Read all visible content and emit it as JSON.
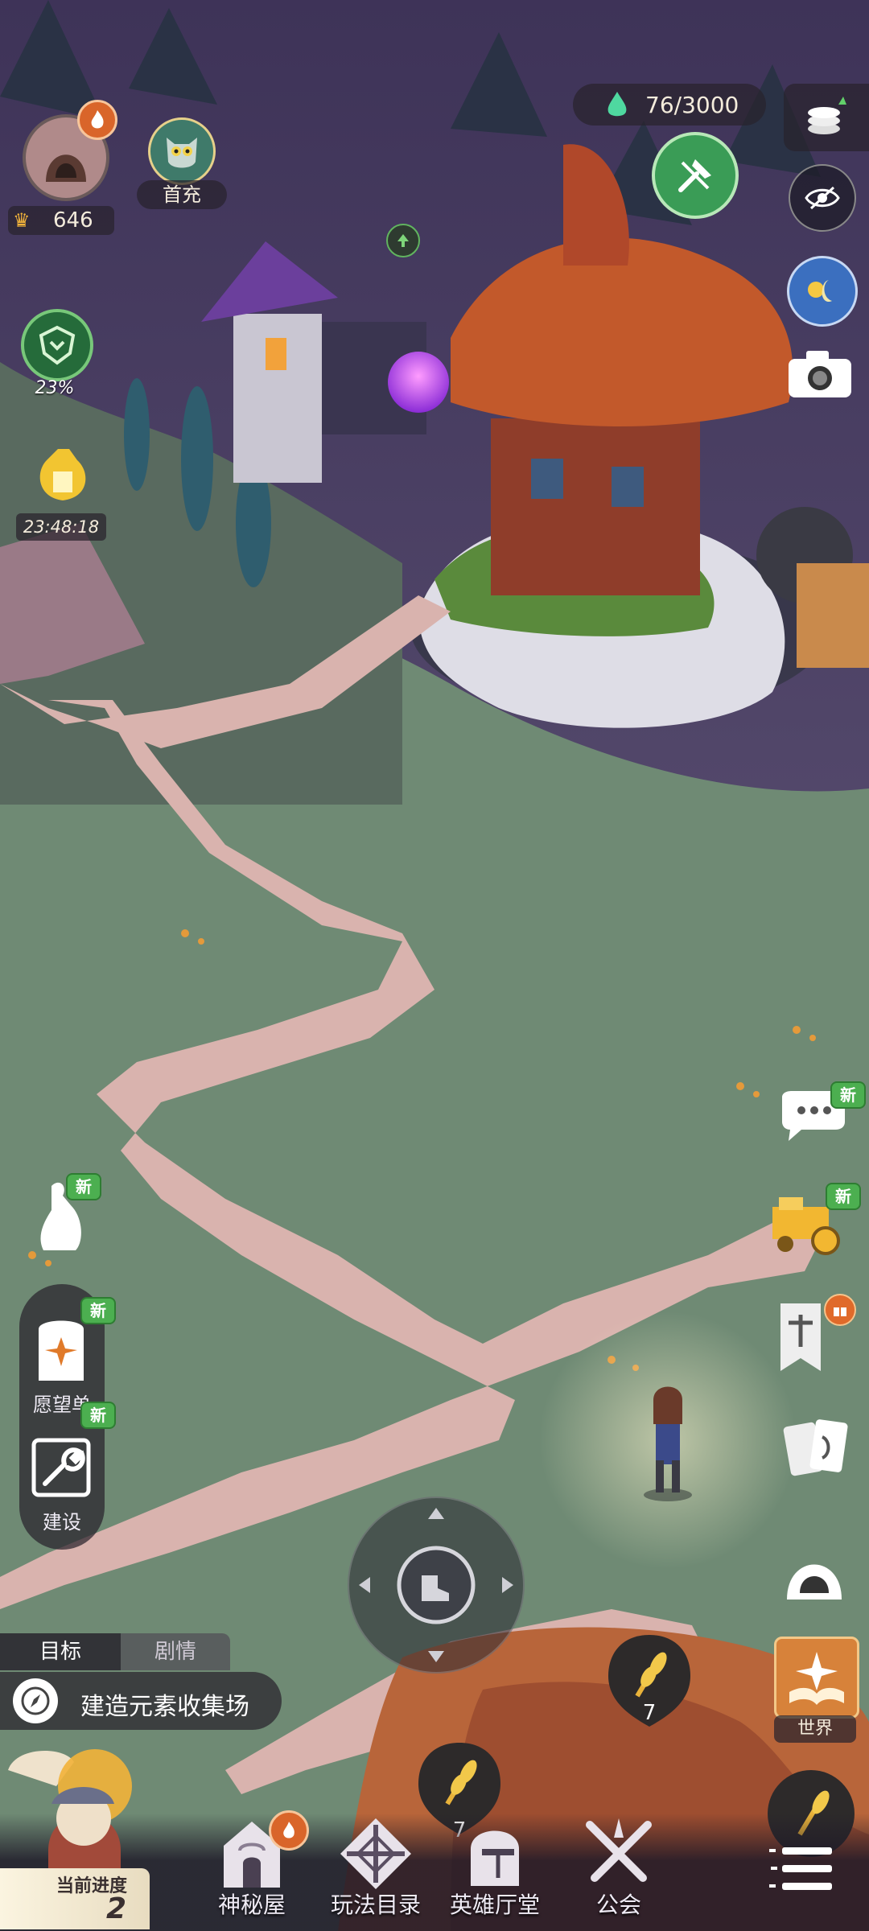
{
  "hud": {
    "player_power": "646",
    "first_recharge_label": "首充",
    "progress_percent": "23%",
    "timer": "23:48:18",
    "energy": "76/3000"
  },
  "left_panel": {
    "wishlist_label": "愿望单",
    "build_label": "建设",
    "new_badge": "新"
  },
  "quest": {
    "tab_goal": "目标",
    "tab_story": "剧情",
    "task_text": "建造元素收集场"
  },
  "right_panel": {
    "world_label": "世界",
    "new_badge": "新"
  },
  "resource_nodes": {
    "node_a_count": "7",
    "node_b_count": "7"
  },
  "bottom_nav": {
    "progress_label": "当前进度",
    "progress_value": "2",
    "items": [
      {
        "label": "神秘屋"
      },
      {
        "label": "玩法目录"
      },
      {
        "label": "英雄厅堂"
      },
      {
        "label": "公会"
      }
    ]
  },
  "colors": {
    "grass": "#6f8a74",
    "path": "#d9b3ae",
    "sky": "#4a3a66",
    "roof": "#c2592b",
    "accent_green": "#3fae58"
  },
  "icons": [
    "flame-icon",
    "owl-icon",
    "arrow-up-icon",
    "shield-emblem-icon",
    "gold-bag-icon",
    "energy-drop-icon",
    "coins-icon",
    "shovel-icon",
    "eye-hide-icon",
    "day-night-icon",
    "camera-icon",
    "chat-icon",
    "cart-icon",
    "gift-icon",
    "cards-icon",
    "hood-icon",
    "book-icon",
    "menu-icon",
    "compass-icon",
    "dpad-icon"
  ]
}
